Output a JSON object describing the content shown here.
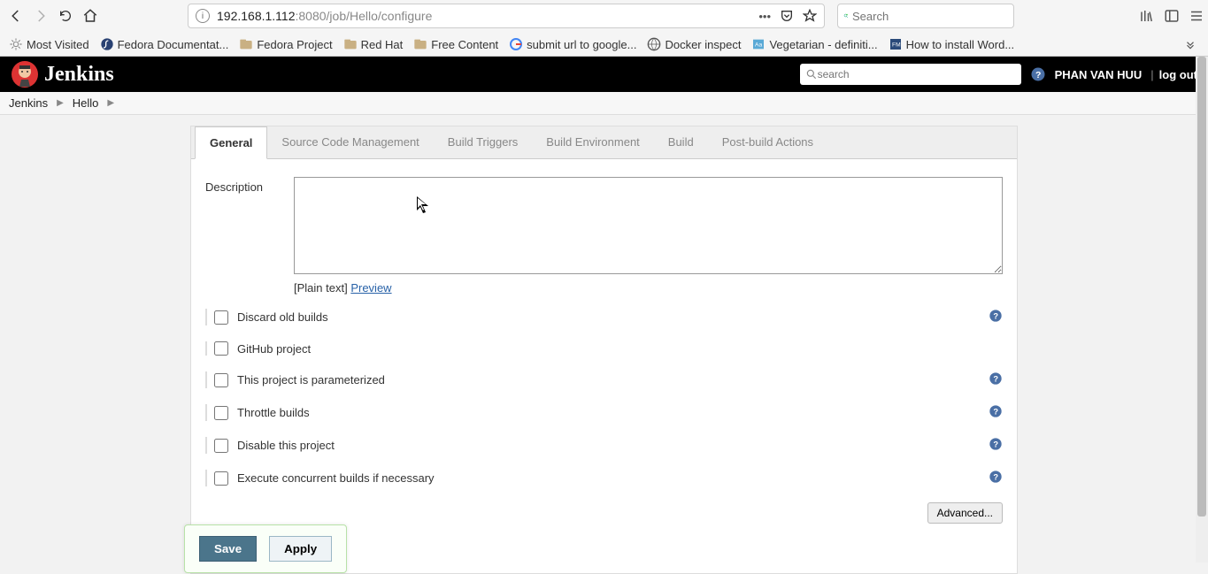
{
  "browser": {
    "url_host": "192.168.1.112",
    "url_path": ":8080/job/Hello/configure",
    "search_placeholder": "Search",
    "bookmarks": [
      {
        "icon": "sun",
        "label": "Most Visited"
      },
      {
        "icon": "fedora",
        "label": "Fedora Documentat..."
      },
      {
        "icon": "folder",
        "label": "Fedora Project"
      },
      {
        "icon": "folder",
        "label": "Red Hat"
      },
      {
        "icon": "folder",
        "label": "Free Content"
      },
      {
        "icon": "google",
        "label": "submit url to google..."
      },
      {
        "icon": "globe",
        "label": "Docker inspect"
      },
      {
        "icon": "dict",
        "label": "Vegetarian - definiti..."
      },
      {
        "icon": "fm",
        "label": "How to install Word..."
      }
    ]
  },
  "jenkins": {
    "logo_text": "Jenkins",
    "search_placeholder": "search",
    "user": "PHAN VAN HUU",
    "logout": "log out",
    "breadcrumbs": [
      "Jenkins",
      "Hello"
    ]
  },
  "tabs": [
    {
      "label": "General",
      "active": true
    },
    {
      "label": "Source Code Management"
    },
    {
      "label": "Build Triggers"
    },
    {
      "label": "Build Environment"
    },
    {
      "label": "Build"
    },
    {
      "label": "Post-build Actions"
    }
  ],
  "form": {
    "description_label": "Description",
    "plain_text_label": "[Plain text]",
    "preview_label": "Preview",
    "checks": [
      {
        "label": "Discard old builds",
        "help": true
      },
      {
        "label": "GitHub project",
        "help": false
      },
      {
        "label": "This project is parameterized",
        "help": true
      },
      {
        "label": "Throttle builds",
        "help": true
      },
      {
        "label": "Disable this project",
        "help": true
      },
      {
        "label": "Execute concurrent builds if necessary",
        "help": true
      }
    ],
    "advanced_label": "Advanced...",
    "save_label": "Save",
    "apply_label": "Apply"
  }
}
